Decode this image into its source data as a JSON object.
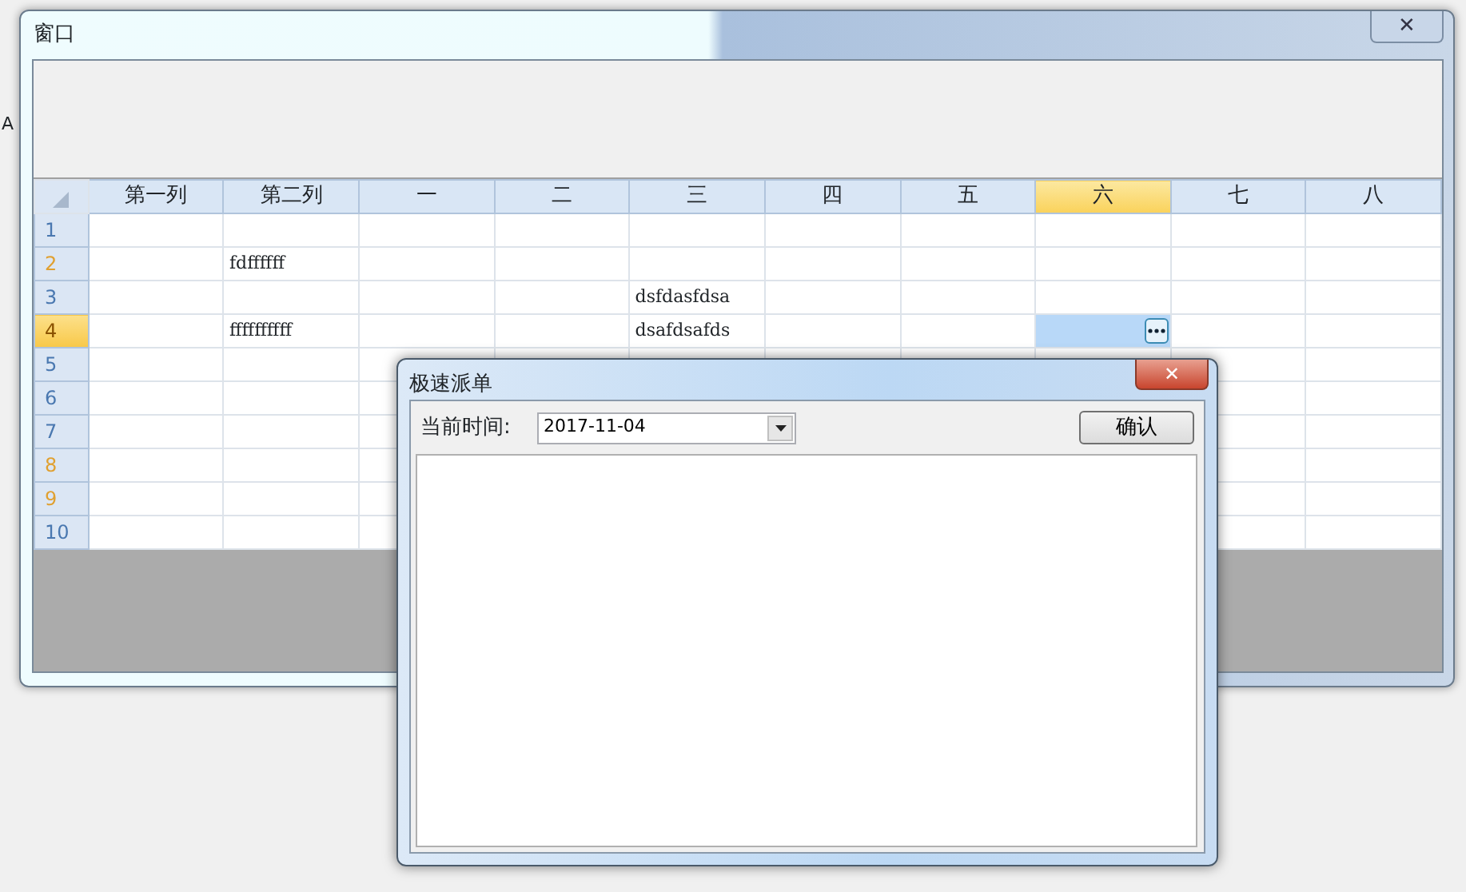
{
  "background": {
    "label": "A"
  },
  "window": {
    "title": "窗口",
    "close": "✕"
  },
  "grid": {
    "columns": [
      {
        "label": "第一列",
        "selected": false
      },
      {
        "label": "第二列",
        "selected": false
      },
      {
        "label": "一",
        "selected": false
      },
      {
        "label": "二",
        "selected": false
      },
      {
        "label": "三",
        "selected": false
      },
      {
        "label": "四",
        "selected": false
      },
      {
        "label": "五",
        "selected": false
      },
      {
        "label": "六",
        "selected": true
      },
      {
        "label": "七",
        "selected": false
      },
      {
        "label": "八",
        "selected": false
      }
    ],
    "rows": [
      {
        "number": "1",
        "color": "#4a78b0",
        "selected": false,
        "cells": [
          null,
          null,
          null,
          null,
          null,
          null,
          null,
          null,
          null,
          null
        ]
      },
      {
        "number": "2",
        "color": "#e0a030",
        "selected": false,
        "cells": [
          null,
          "fdffffff",
          null,
          null,
          null,
          null,
          null,
          null,
          null,
          null
        ]
      },
      {
        "number": "3",
        "color": "#4a78b0",
        "selected": false,
        "cells": [
          null,
          null,
          null,
          null,
          "dsfdasfdsa",
          null,
          null,
          null,
          null,
          null
        ]
      },
      {
        "number": "4",
        "color": "#8a5200",
        "selected": true,
        "cells": [
          null,
          "ffffffffff",
          null,
          null,
          "dsafdsafds",
          null,
          null,
          null,
          null,
          null
        ]
      },
      {
        "number": "5",
        "color": "#4a78b0",
        "selected": false,
        "cells": [
          null,
          null,
          null,
          null,
          null,
          null,
          null,
          null,
          null,
          null
        ]
      },
      {
        "number": "6",
        "color": "#4a78b0",
        "selected": false,
        "cells": [
          null,
          null,
          null,
          null,
          null,
          null,
          null,
          null,
          null,
          null
        ]
      },
      {
        "number": "7",
        "color": "#4a78b0",
        "selected": false,
        "cells": [
          null,
          null,
          null,
          null,
          null,
          null,
          null,
          null,
          null,
          null
        ]
      },
      {
        "number": "8",
        "color": "#e0a030",
        "selected": false,
        "cells": [
          null,
          null,
          null,
          null,
          null,
          null,
          null,
          null,
          null,
          null
        ]
      },
      {
        "number": "9",
        "color": "#e0a030",
        "selected": false,
        "cells": [
          null,
          null,
          null,
          null,
          null,
          null,
          null,
          null,
          null,
          null
        ]
      },
      {
        "number": "10",
        "color": "#4a78b0",
        "selected": false,
        "cells": [
          null,
          null,
          null,
          null,
          null,
          null,
          null,
          null,
          null,
          null
        ]
      }
    ]
  },
  "dialog": {
    "title": "极速派单",
    "close": "✕",
    "date_label": "当前时间:",
    "date_value": "2017-11-04",
    "confirm_button": "确认"
  }
}
